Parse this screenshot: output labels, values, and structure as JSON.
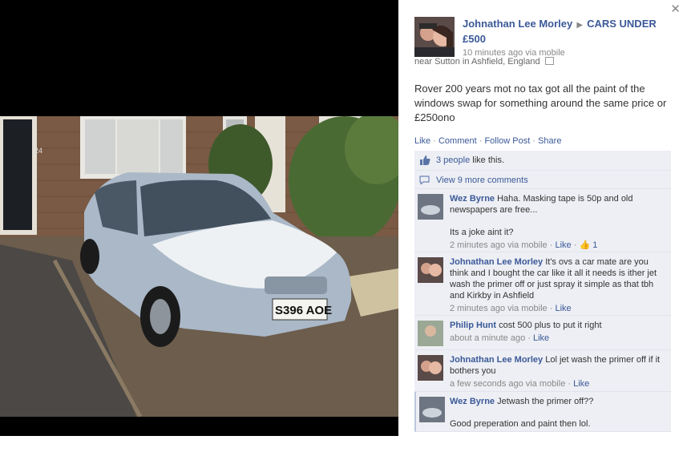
{
  "post": {
    "author": "Johnathan Lee Morley",
    "group": "CARS UNDER £500",
    "time": "10 minutes ago via mobile",
    "location": "near Sutton in Ashfield, England",
    "text": "Rover 200 years mot no tax got all the paint of the windows swap for something around the same price or £250ono",
    "actions": [
      "Like",
      "Comment",
      "Follow Post",
      "Share"
    ]
  },
  "ufi": {
    "likes_link": "3 people",
    "likes_suffix": " like this.",
    "more_comments": "View 9 more comments"
  },
  "comments": [
    {
      "name": "Wez Byrne",
      "text": "Haha. Masking tape is 50p and old newspapers are free...",
      "text2": "Its a joke aint it?",
      "time": "2 minutes ago via mobile",
      "like": "Like",
      "likes": "1"
    },
    {
      "name": "Johnathan Lee Morley",
      "text": "It's ovs a car mate are you think and I bought the car like it all it needs is ither jet wash the primer off or just spray it simple as that tbh and Kirkby in Ashfield",
      "time": "2 minutes ago via mobile",
      "like": "Like"
    },
    {
      "name": "Philip Hunt",
      "text": "cost 500 plus to put it right",
      "time": "about a minute ago",
      "like": "Like"
    },
    {
      "name": "Johnathan Lee Morley",
      "text": "Lol jet wash the primer off if it bothers you",
      "time": "a few seconds ago via mobile",
      "like": "Like"
    },
    {
      "name": "Wez Byrne",
      "text": "Jetwash the primer off??",
      "text2": "Good preperation and paint then lol."
    }
  ],
  "photo": {
    "plate": "S396 AOE",
    "house_number": "24"
  },
  "icons": {
    "close": "close-icon",
    "like": "thumbs-up-icon",
    "comments": "comment-bubble-icon",
    "map": "map-icon"
  },
  "colors": {
    "link": "#3b5998",
    "ufi_bg": "#edeff4",
    "meta": "#888888",
    "car": "#aab8c8",
    "primer": "#eef1f3"
  }
}
